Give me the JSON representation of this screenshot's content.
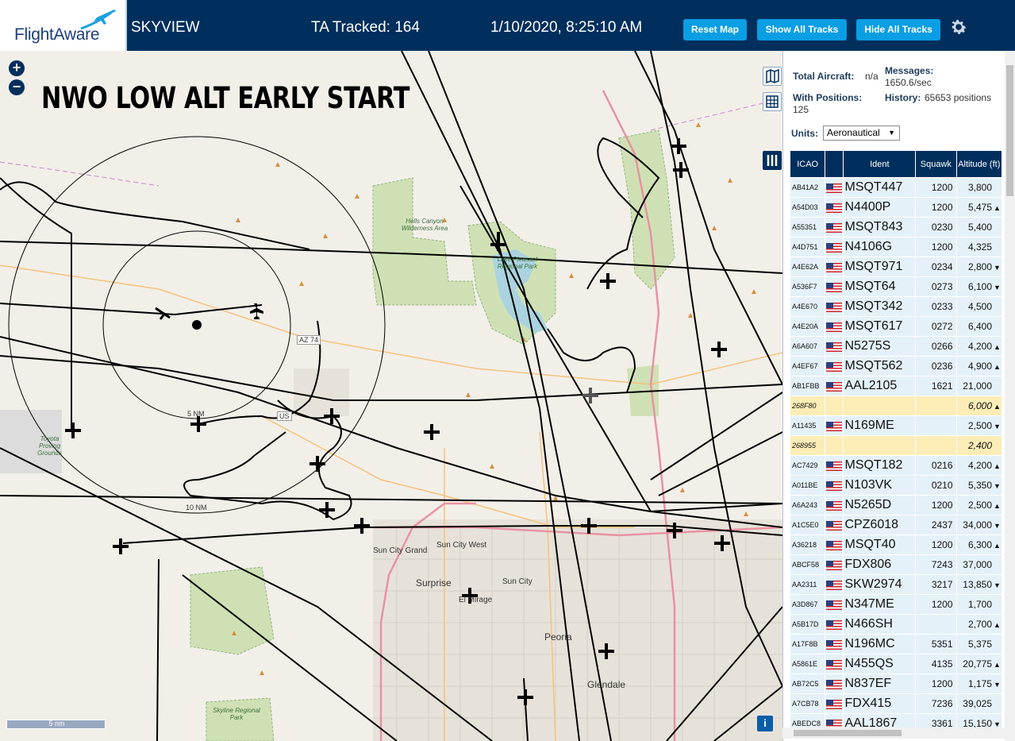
{
  "header": {
    "brand": "FlightAware",
    "app_title": "SKYVIEW",
    "tracked": "TA Tracked: 164",
    "datetime": "1/10/2020, 8:25:10 AM",
    "buttons": {
      "reset": "Reset Map",
      "show_all": "Show All Tracks",
      "hide_all": "Hide All Tracks"
    },
    "settings_icon": "gear-icon"
  },
  "map": {
    "overlay_title": "NWO LOW ALT EARLY START",
    "zoom_in": "+",
    "zoom_out": "−",
    "scale": "5 nm",
    "info": "i",
    "ring_labels": {
      "inner": "5 NM",
      "outer": "10 NM"
    },
    "places": [
      "Hells Canyon Wilderness Area",
      "Lake Pleasant Regional Park",
      "Sun City Grand",
      "Sun City West",
      "Surprise",
      "Sun City",
      "El Mirage",
      "Peoria",
      "Glendale",
      "Skyline Regional Park",
      "Toyota Proving Grounds"
    ],
    "road_labels": {
      "az74": "AZ 74",
      "us60": "US"
    },
    "colors": {
      "track": "#000000",
      "map_bg": "#f2efe9",
      "park": "#cfe1b4",
      "water": "#aad3df",
      "highway": "#e892a2",
      "arterial": "#f5c27a"
    }
  },
  "panel": {
    "total_aircraft_label": "Total Aircraft:",
    "total_aircraft": "n/a",
    "with_positions_label": "With Positions:",
    "with_positions": "125",
    "messages_label": "Messages:",
    "messages": "1650.6/sec",
    "history_label": "History:",
    "history": "65653 positions",
    "units_label": "Units:",
    "units_value": "Aeronautical",
    "columns": {
      "icao": "ICAO",
      "flag": "",
      "ident": "Ident",
      "squawk": "Squawk",
      "altitude": "Altitude (ft)"
    },
    "rows": [
      {
        "icao": "AB41A2",
        "ident": "MSQT447",
        "squawk": "1200",
        "alt": "3,800",
        "trend": "",
        "hl": false
      },
      {
        "icao": "A54D03",
        "ident": "N4400P",
        "squawk": "1200",
        "alt": "5,475",
        "trend": "▲",
        "hl": false
      },
      {
        "icao": "A55351",
        "ident": "MSQT843",
        "squawk": "0230",
        "alt": "5,400",
        "trend": "",
        "hl": false
      },
      {
        "icao": "A4D751",
        "ident": "N4106G",
        "squawk": "1200",
        "alt": "4,325",
        "trend": "",
        "hl": false
      },
      {
        "icao": "A4E62A",
        "ident": "MSQT971",
        "squawk": "0234",
        "alt": "2,800",
        "trend": "▼",
        "hl": false
      },
      {
        "icao": "A536F7",
        "ident": "MSQT64",
        "squawk": "0273",
        "alt": "6,100",
        "trend": "▼",
        "hl": false
      },
      {
        "icao": "A4E670",
        "ident": "MSQT342",
        "squawk": "0233",
        "alt": "4,500",
        "trend": "",
        "hl": false
      },
      {
        "icao": "A4E20A",
        "ident": "MSQT617",
        "squawk": "0272",
        "alt": "6,400",
        "trend": "",
        "hl": false
      },
      {
        "icao": "A6A607",
        "ident": "N5275S",
        "squawk": "0266",
        "alt": "4,200",
        "trend": "▲",
        "hl": false
      },
      {
        "icao": "A4EF67",
        "ident": "MSQT562",
        "squawk": "0236",
        "alt": "4,900",
        "trend": "▲",
        "hl": false
      },
      {
        "icao": "AB1FBB",
        "ident": "AAL2105",
        "squawk": "1621",
        "alt": "21,000",
        "trend": "",
        "hl": false
      },
      {
        "icao": "268F80",
        "ident": "",
        "squawk": "",
        "alt": "6,000",
        "trend": "▲",
        "hl": true
      },
      {
        "icao": "A11435",
        "ident": "N169ME",
        "squawk": "",
        "alt": "2,500",
        "trend": "▼",
        "hl": false
      },
      {
        "icao": "268955",
        "ident": "",
        "squawk": "",
        "alt": "2,400",
        "trend": "",
        "hl": true
      },
      {
        "icao": "AC7429",
        "ident": "MSQT182",
        "squawk": "0216",
        "alt": "4,200",
        "trend": "▲",
        "hl": false
      },
      {
        "icao": "A011BE",
        "ident": "N103VK",
        "squawk": "0210",
        "alt": "5,350",
        "trend": "▼",
        "hl": false
      },
      {
        "icao": "A6A243",
        "ident": "N5265D",
        "squawk": "1200",
        "alt": "2,500",
        "trend": "▲",
        "hl": false
      },
      {
        "icao": "A1C5E0",
        "ident": "CPZ6018",
        "squawk": "2437",
        "alt": "34,000",
        "trend": "▼",
        "hl": false
      },
      {
        "icao": "A36218",
        "ident": "MSQT40",
        "squawk": "1200",
        "alt": "6,300",
        "trend": "▲",
        "hl": false
      },
      {
        "icao": "ABCF58",
        "ident": "FDX806",
        "squawk": "7243",
        "alt": "37,000",
        "trend": "",
        "hl": false
      },
      {
        "icao": "AA2311",
        "ident": "SKW2974",
        "squawk": "3217",
        "alt": "13,850",
        "trend": "▼",
        "hl": false
      },
      {
        "icao": "A3D867",
        "ident": "N347ME",
        "squawk": "1200",
        "alt": "1,700",
        "trend": "",
        "hl": false
      },
      {
        "icao": "A5B17D",
        "ident": "N466SH",
        "squawk": "",
        "alt": "2,700",
        "trend": "▲",
        "hl": false
      },
      {
        "icao": "A17F8B",
        "ident": "N196MC",
        "squawk": "5351",
        "alt": "5,375",
        "trend": "",
        "hl": false
      },
      {
        "icao": "A5861E",
        "ident": "N455QS",
        "squawk": "4135",
        "alt": "20,775",
        "trend": "▲",
        "hl": false
      },
      {
        "icao": "AB72C5",
        "ident": "N837EF",
        "squawk": "1200",
        "alt": "1,175",
        "trend": "▼",
        "hl": false
      },
      {
        "icao": "A7CB78",
        "ident": "FDX415",
        "squawk": "7236",
        "alt": "39,025",
        "trend": "",
        "hl": false
      },
      {
        "icao": "ABEDC8",
        "ident": "AAL1867",
        "squawk": "3361",
        "alt": "15,150",
        "trend": "▼",
        "hl": false
      }
    ]
  }
}
